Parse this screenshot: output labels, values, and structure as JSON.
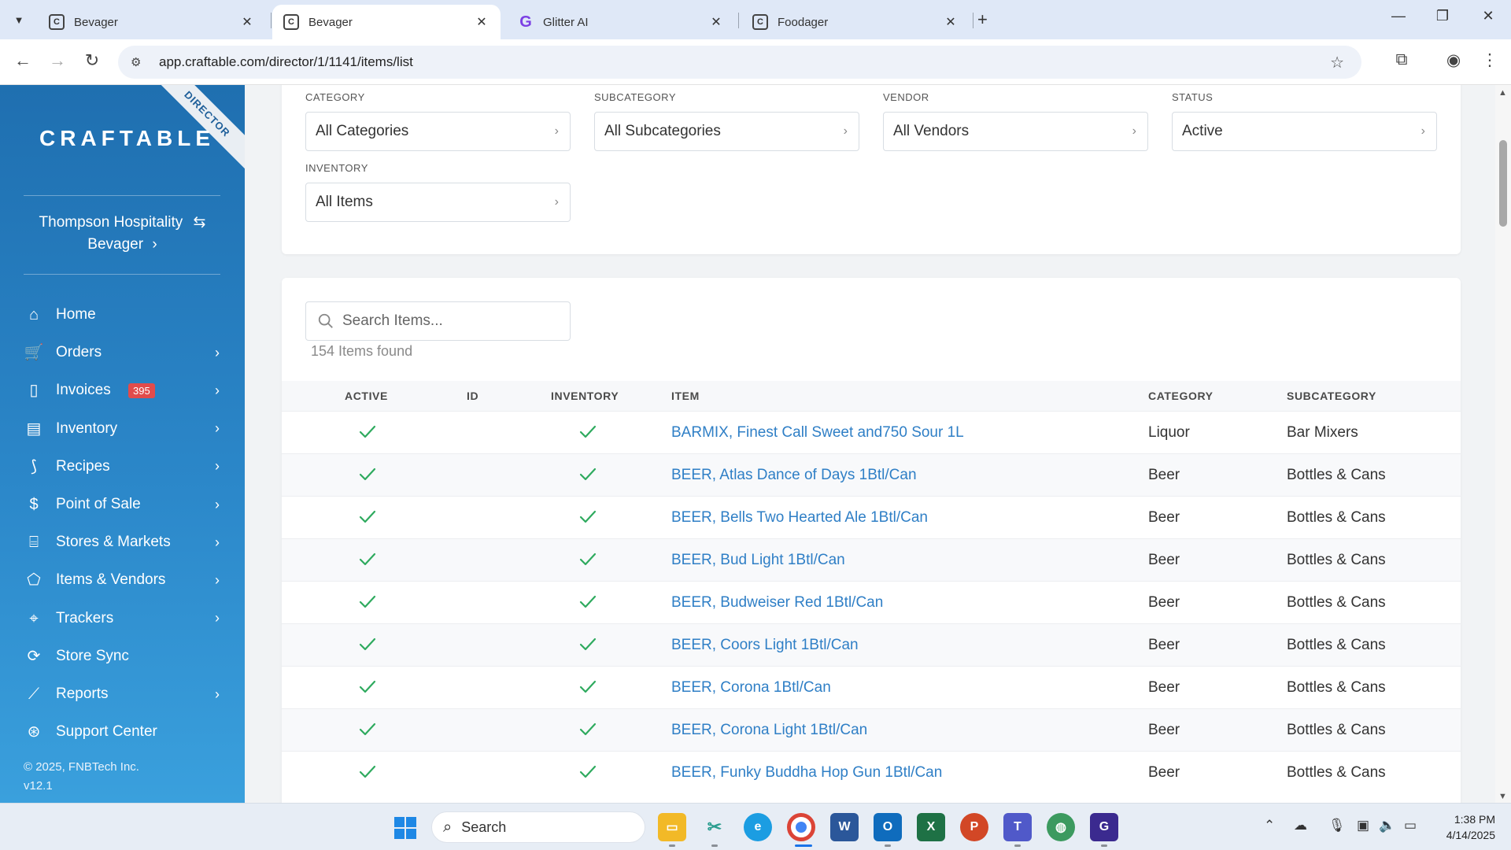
{
  "browser": {
    "tabs": [
      {
        "title": "Bevager",
        "favicon": "C",
        "active": false
      },
      {
        "title": "Bevager",
        "favicon": "C",
        "active": true
      },
      {
        "title": "Glitter AI",
        "favicon": "G",
        "active": false
      },
      {
        "title": "Foodager",
        "favicon": "C",
        "active": false
      }
    ],
    "url": "app.craftable.com/director/1/1141/items/list"
  },
  "sidebar": {
    "ribbon": "DIRECTOR",
    "logo": "CRAFTABLE",
    "org_name": "Thompson Hospitality",
    "org_unit": "Bevager",
    "items": [
      {
        "label": "Home",
        "icon": "home-icon",
        "chevron": false
      },
      {
        "label": "Orders",
        "icon": "cart-icon",
        "chevron": true
      },
      {
        "label": "Invoices",
        "icon": "clipboard-icon",
        "chevron": true,
        "badge": "395"
      },
      {
        "label": "Inventory",
        "icon": "inventory-icon",
        "chevron": true
      },
      {
        "label": "Recipes",
        "icon": "recipe-icon",
        "chevron": true
      },
      {
        "label": "Point of Sale",
        "icon": "dollar-icon",
        "chevron": true
      },
      {
        "label": "Stores & Markets",
        "icon": "store-icon",
        "chevron": true
      },
      {
        "label": "Items & Vendors",
        "icon": "tag-icon",
        "chevron": true
      },
      {
        "label": "Trackers",
        "icon": "pin-icon",
        "chevron": true
      },
      {
        "label": "Store Sync",
        "icon": "sync-icon",
        "chevron": false
      },
      {
        "label": "Reports",
        "icon": "chart-icon",
        "chevron": true
      },
      {
        "label": "Support Center",
        "icon": "support-icon",
        "chevron": false
      }
    ],
    "copyright": "© 2025, FNBTech Inc.",
    "version": "v12.1"
  },
  "filters": {
    "category": {
      "label": "CATEGORY",
      "value": "All Categories"
    },
    "subcategory": {
      "label": "SUBCATEGORY",
      "value": "All Subcategories"
    },
    "vendor": {
      "label": "VENDOR",
      "value": "All Vendors"
    },
    "status": {
      "label": "STATUS",
      "value": "Active"
    },
    "inventory": {
      "label": "INVENTORY",
      "value": "All Items"
    }
  },
  "search": {
    "placeholder": "Search Items...",
    "found": "154 Items found"
  },
  "table": {
    "headers": {
      "active": "ACTIVE",
      "id": "ID",
      "inventory": "INVENTORY",
      "item": "ITEM",
      "category": "CATEGORY",
      "subcategory": "SUBCATEGORY"
    },
    "rows": [
      {
        "active": true,
        "id": "",
        "inventory": true,
        "item": "BARMIX, Finest Call Sweet and750 Sour 1L",
        "category": "Liquor",
        "subcategory": "Bar Mixers"
      },
      {
        "active": true,
        "id": "",
        "inventory": true,
        "item": "BEER, Atlas Dance of Days 1Btl/Can",
        "category": "Beer",
        "subcategory": "Bottles & Cans"
      },
      {
        "active": true,
        "id": "",
        "inventory": true,
        "item": "BEER, Bells Two Hearted Ale 1Btl/Can",
        "category": "Beer",
        "subcategory": "Bottles & Cans"
      },
      {
        "active": true,
        "id": "",
        "inventory": true,
        "item": "BEER, Bud Light 1Btl/Can",
        "category": "Beer",
        "subcategory": "Bottles & Cans"
      },
      {
        "active": true,
        "id": "",
        "inventory": true,
        "item": "BEER, Budweiser Red 1Btl/Can",
        "category": "Beer",
        "subcategory": "Bottles & Cans"
      },
      {
        "active": true,
        "id": "",
        "inventory": true,
        "item": "BEER, Coors Light 1Btl/Can",
        "category": "Beer",
        "subcategory": "Bottles & Cans"
      },
      {
        "active": true,
        "id": "",
        "inventory": true,
        "item": "BEER, Corona 1Btl/Can",
        "category": "Beer",
        "subcategory": "Bottles & Cans"
      },
      {
        "active": true,
        "id": "",
        "inventory": true,
        "item": "BEER, Corona Light 1Btl/Can",
        "category": "Beer",
        "subcategory": "Bottles & Cans"
      },
      {
        "active": true,
        "id": "",
        "inventory": true,
        "item": "BEER, Funky Buddha Hop Gun 1Btl/Can",
        "category": "Beer",
        "subcategory": "Bottles & Cans"
      }
    ]
  },
  "taskbar": {
    "search_label": "Search",
    "time": "1:38 PM",
    "date": "4/14/2025"
  },
  "colors": {
    "sidebar_top": "#1f6fb0",
    "sidebar_bottom": "#3aa0dd",
    "link": "#2f7fc6",
    "check": "#2eaa5e",
    "badge": "#e24b4b"
  }
}
